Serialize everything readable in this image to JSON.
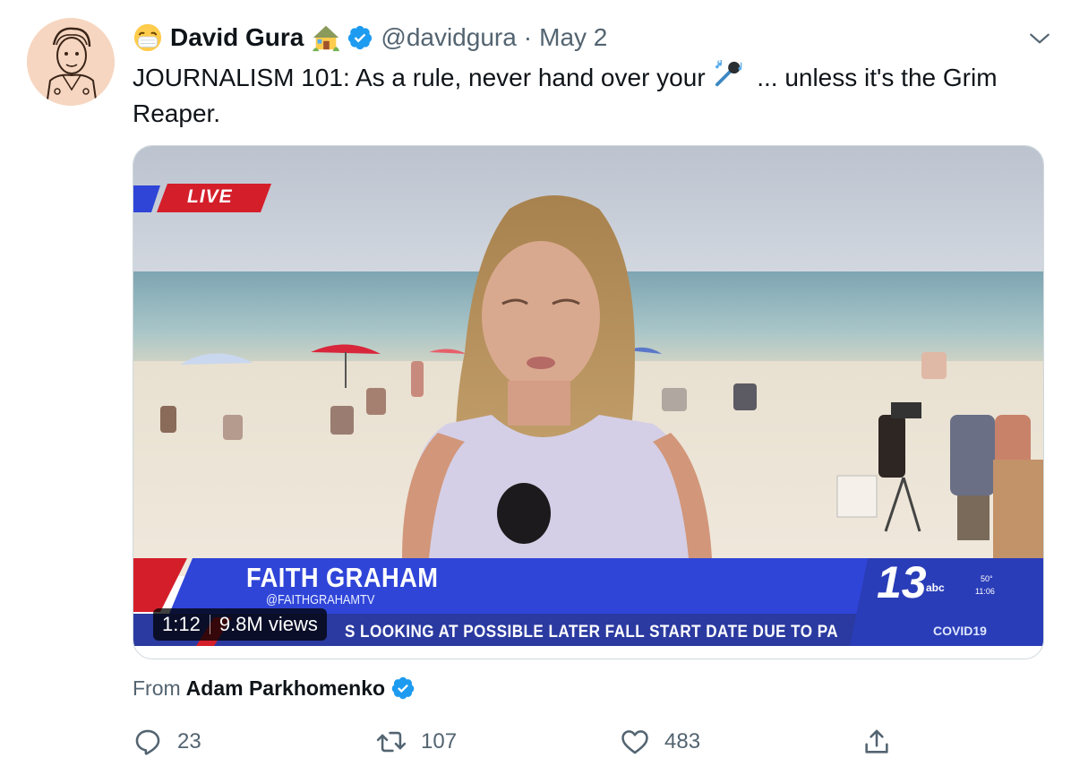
{
  "tweet": {
    "author_name": "David Gura",
    "handle": "@davidgura",
    "separator": "·",
    "date": "May 2",
    "text_before": "JOURNALISM 101: As a rule, never hand over your",
    "text_after": "... unless it's the Grim Reaper.",
    "icons": {
      "author_emoji": "mask-face-icon",
      "house_emoji": "house-icon",
      "verified": "verified-badge-icon",
      "inline_emoji": "microphone-icon",
      "more": "chevron-down-icon"
    }
  },
  "video": {
    "live_label": "LIVE",
    "reporter_name": "FAITH GRAHAM",
    "reporter_handle": "@FAITHGRAHAMTV",
    "ticker": "S LOOKING AT POSSIBLE LATER FALL START DATE DUE TO PA",
    "channel_number": "13",
    "channel_network": "abc",
    "temperature": "50°",
    "clock": "11:06",
    "ticker_tag": "COVID19",
    "duration": "1:12",
    "views": "9.8M views"
  },
  "attribution": {
    "prefix": "From",
    "name": "Adam Parkhomenko"
  },
  "actions": {
    "replies": "23",
    "retweets": "107",
    "likes": "483"
  },
  "colors": {
    "verified": "#1d9bf0",
    "secondary_text": "#536471",
    "primary_text": "#0f1419",
    "lower_third_blue": "#2f45d8",
    "live_red": "#d41f2b"
  }
}
